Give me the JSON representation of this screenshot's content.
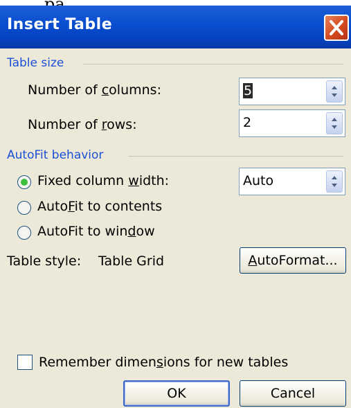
{
  "cutoff_text": "，pa            ，",
  "dialog": {
    "title": "Insert Table",
    "close_icon": "close-icon"
  },
  "table_size": {
    "group_label": "Table size",
    "columns_label_pre": "Number of ",
    "columns_label_mnemonic": "c",
    "columns_label_post": "olumns:",
    "columns_value": "5",
    "rows_label_pre": "Number of ",
    "rows_label_mnemonic": "r",
    "rows_label_post": "ows:",
    "rows_value": "2"
  },
  "autofit": {
    "group_label": "AutoFit behavior",
    "fixed_pre": "Fixed column ",
    "fixed_mnemonic": "w",
    "fixed_post": "idth:",
    "fixed_value": "Auto",
    "contents_pre": "Auto",
    "contents_mnemonic": "F",
    "contents_post": "it to contents",
    "window_pre": "AutoFit to win",
    "window_mnemonic": "d",
    "window_post": "ow",
    "selected": "fixed"
  },
  "table_style": {
    "label": "Table style:",
    "value": "Table Grid",
    "autoformat_mnemonic": "A",
    "autoformat_post": "utoFormat..."
  },
  "remember": {
    "pre": "Remember dimen",
    "mnemonic": "s",
    "post": "ions for new tables",
    "checked": false
  },
  "buttons": {
    "ok": "OK",
    "cancel": "Cancel"
  }
}
